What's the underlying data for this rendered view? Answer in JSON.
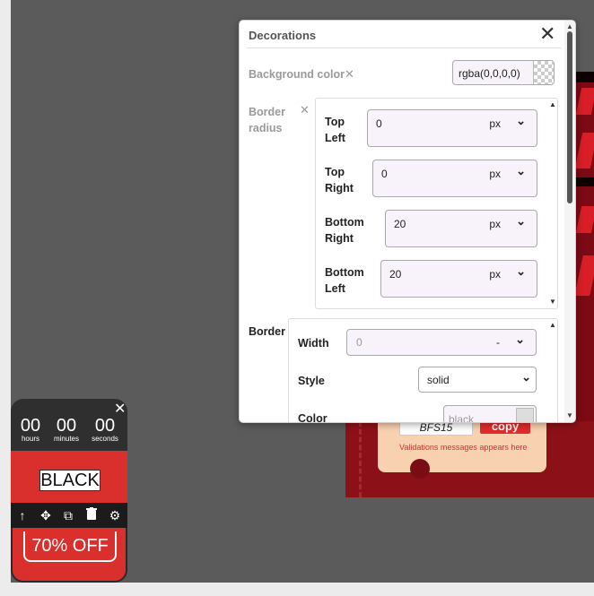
{
  "dialog": {
    "title": "Decorations",
    "background_color": {
      "label": "Background color",
      "value": "rgba(0,0,0,0)"
    },
    "border_radius": {
      "label_line1": "Border",
      "label_line2": "radius",
      "corners": [
        {
          "line1": "Top",
          "line2": "Left",
          "value": "0",
          "unit": "px"
        },
        {
          "line1": "Top",
          "line2": "Right",
          "value": "0",
          "unit": "px"
        },
        {
          "line1": "Bottom",
          "line2": "Right",
          "value": "20",
          "unit": "px"
        },
        {
          "line1": "Bottom",
          "line2": "Left",
          "value": "20",
          "unit": "px"
        }
      ]
    },
    "border": {
      "label": "Border",
      "width_label": "Width",
      "width_placeholder": "0",
      "width_unit": "-",
      "style_label": "Style",
      "style_value": "solid",
      "color_label": "Color",
      "color_placeholder": "black"
    }
  },
  "widget": {
    "timer": [
      {
        "value": "00",
        "label": "hours"
      },
      {
        "value": "00",
        "label": "minutes"
      },
      {
        "value": "00",
        "label": "seconds"
      }
    ],
    "text": "BLACK",
    "offer": "70% OFF",
    "toolbar_icons": [
      "arrow-up-icon",
      "move-icon",
      "duplicate-icon",
      "trash-icon",
      "gear-icon"
    ]
  },
  "banner": {
    "coupon_code": "BFS15",
    "copy_label": "copy",
    "validation": "Validations messages appears here"
  },
  "colors": {
    "accent_red": "#d9302e",
    "dialog_bg": "#ffffff",
    "input_bg": "#f8f2fb"
  }
}
